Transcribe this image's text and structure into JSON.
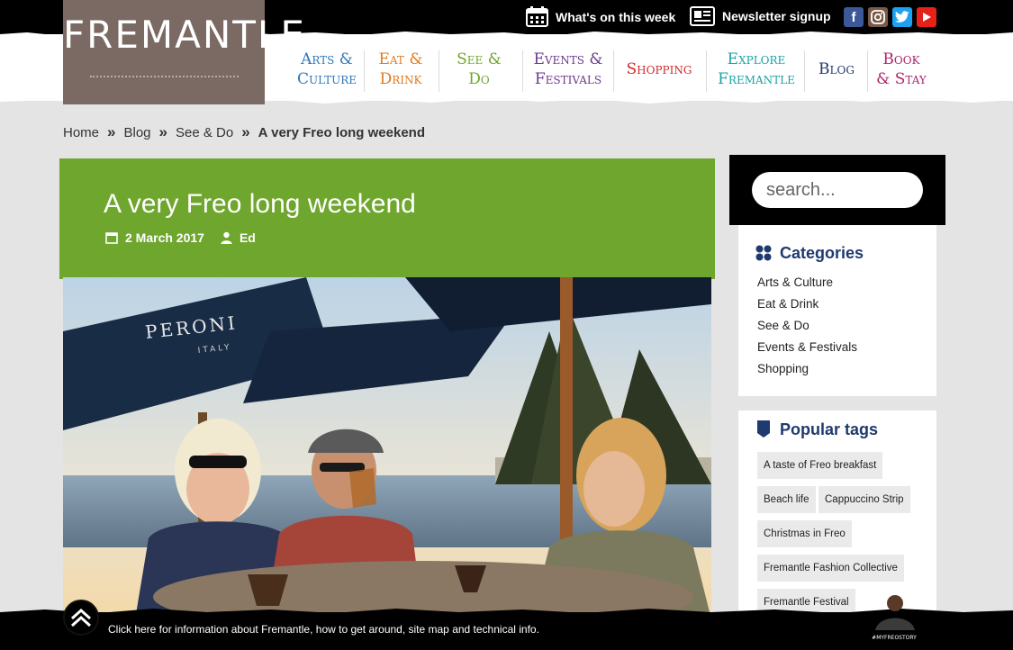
{
  "topbar": {
    "whats_on": "What's on this week",
    "newsletter": "Newsletter signup",
    "social": [
      "facebook-icon",
      "instagram-icon",
      "twitter-icon",
      "youtube-icon"
    ]
  },
  "logo": {
    "name": "FREMANTLE"
  },
  "nav": [
    {
      "line1": "Arts &",
      "line2": "Culture",
      "color": "#2f77b8"
    },
    {
      "line1": "Eat &",
      "line2": "Drink",
      "color": "#e07a1e"
    },
    {
      "line1": "See & Do",
      "line2": "",
      "color": "#6fa62e"
    },
    {
      "line1": "Events &",
      "line2": "Festivals",
      "color": "#6a3a8c"
    },
    {
      "line1": "Shopping",
      "line2": "",
      "color": "#d12a2a"
    },
    {
      "line1": "Explore",
      "line2": "Fremantle",
      "color": "#1aa3a3"
    },
    {
      "line1": "Blog",
      "line2": "",
      "color": "#1e3a6e"
    },
    {
      "line1": "Book",
      "line2": "& Stay",
      "color": "#b0256b"
    }
  ],
  "breadcrumb": {
    "items": [
      "Home",
      "Blog",
      "See & Do"
    ],
    "current": "A very Freo long weekend"
  },
  "article": {
    "title": "A very Freo long weekend",
    "date": "2 March 2017",
    "author": "Ed",
    "header_color": "#6fa62e",
    "umbrella_brand": "PERONI",
    "umbrella_sub": "ITALY"
  },
  "search": {
    "placeholder": "search..."
  },
  "categories": {
    "title": "Categories",
    "items": [
      "Arts & Culture",
      "Eat & Drink",
      "See & Do",
      "Events & Festivals",
      "Shopping"
    ]
  },
  "tags": {
    "title": "Popular tags",
    "items": [
      "A taste of Freo breakfast",
      "Beach life",
      "Cappuccino Strip",
      "Christmas in Freo",
      "Fremantle Fashion Collective",
      "Fremantle Festival"
    ]
  },
  "footer": {
    "text": "Click here for information about Fremantle, how to get around, site map and technical info.",
    "badge": "#MYFREOSTORY"
  }
}
